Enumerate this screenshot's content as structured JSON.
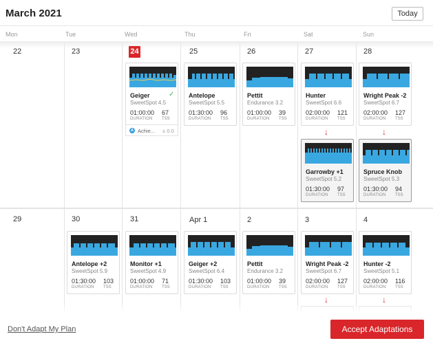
{
  "header": {
    "month_title": "March 2021",
    "today_label": "Today"
  },
  "days_of_week": [
    "Mon",
    "Tue",
    "Wed",
    "Thu",
    "Fri",
    "Sat",
    "Sun"
  ],
  "weeks": [
    {
      "days": [
        "22",
        "23",
        "24",
        "25",
        "26",
        "27",
        "28"
      ]
    },
    {
      "days": [
        "29",
        "30",
        "31",
        "Apr 1",
        "2",
        "3",
        "4"
      ]
    }
  ],
  "today_day": "24",
  "workouts": [
    {
      "name": "Geiger",
      "type": "SweetSpot 4.5",
      "duration": "01:00:00",
      "tss": "67",
      "completed": true,
      "graph": "geiger"
    },
    {
      "name": "Antelope",
      "type": "SweetSpot 5.5",
      "duration": "01:30:00",
      "tss": "96",
      "graph": "antelope"
    },
    {
      "name": "Pettit",
      "type": "Endurance 3.2",
      "duration": "01:00:00",
      "tss": "39",
      "graph": "pettit"
    },
    {
      "name": "Hunter",
      "type": "SweetSpot 6.6",
      "duration": "02:00:00",
      "tss": "121",
      "graph": "hunter"
    },
    {
      "name": "Wright Peak -2",
      "type": "SweetSpot 6.7",
      "duration": "02:00:00",
      "tss": "127",
      "graph": "wright"
    },
    {
      "name": "Garrowby +1",
      "type": "SweetSpot 5.2",
      "duration": "01:30:00",
      "tss": "97",
      "adapted": true,
      "graph": "garrowby"
    },
    {
      "name": "Spruce Knob",
      "type": "SweetSpot 5.3",
      "duration": "01:30:00",
      "tss": "94",
      "adapted": true,
      "graph": "spruce"
    },
    {
      "name": "Antelope +2",
      "type": "SweetSpot 5.9",
      "duration": "01:30:00",
      "tss": "103",
      "graph": "antelope2"
    },
    {
      "name": "Monitor +1",
      "type": "SweetSpot 4.9",
      "duration": "01:00:00",
      "tss": "71",
      "graph": "monitor"
    },
    {
      "name": "Geiger +2",
      "type": "SweetSpot 6.4",
      "duration": "01:30:00",
      "tss": "103",
      "graph": "geiger2"
    },
    {
      "name": "Pettit",
      "type": "Endurance 3.2",
      "duration": "01:00:00",
      "tss": "39",
      "graph": "pettit"
    },
    {
      "name": "Wright Peak -2",
      "type": "SweetSpot 6.7",
      "duration": "02:00:00",
      "tss": "127",
      "graph": "wright"
    },
    {
      "name": "Hunter -2",
      "type": "SweetSpot 5.1",
      "duration": "02:00:00",
      "tss": "116",
      "graph": "hunter2"
    }
  ],
  "labels": {
    "duration": "DURATION",
    "tss": "TSS"
  },
  "achievement_note": {
    "text": "Achie...",
    "value": "± 0.0",
    "icon": "achievement-icon"
  },
  "footer": {
    "dont_adapt_label": "Don't Adapt My Plan",
    "accept_label": "Accept Adaptations"
  },
  "colors": {
    "accent": "#d9262a",
    "graph_bg": "#222222",
    "graph_fill": "#3aa8e0",
    "completed": "#4caf50"
  }
}
